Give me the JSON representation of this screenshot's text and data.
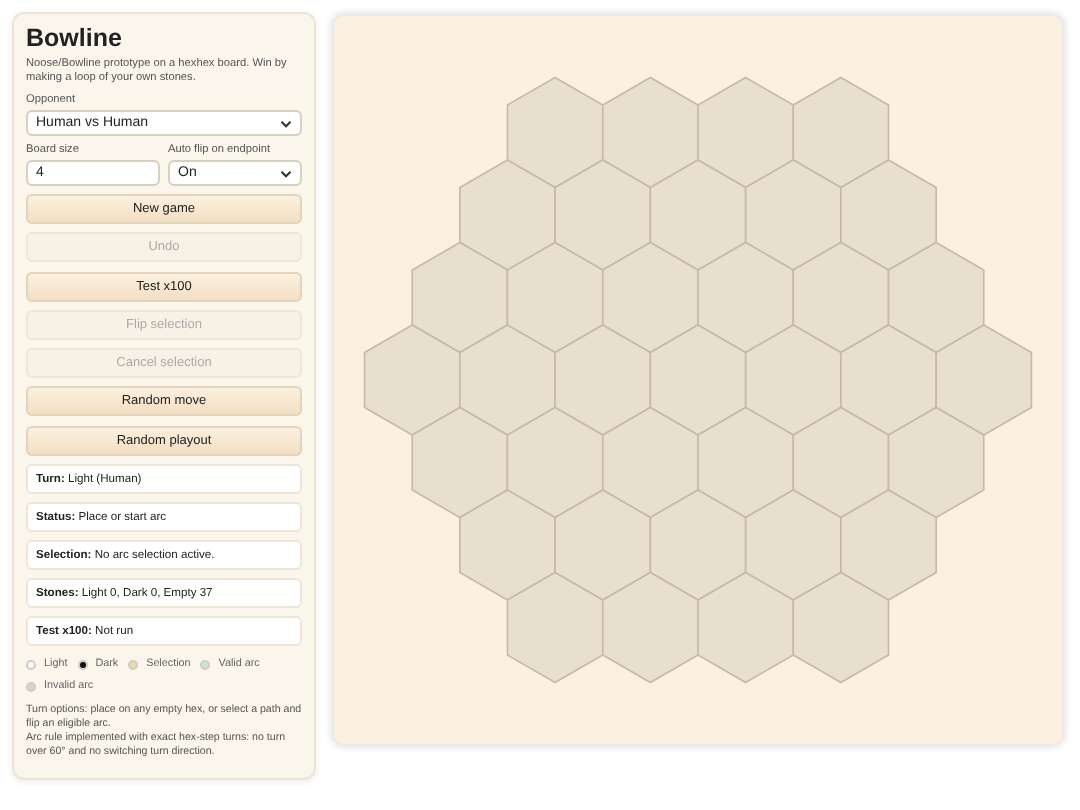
{
  "title": "Bowline",
  "description": "Noose/Bowline prototype on a hexhex board. Win by making a loop of your own stones.",
  "opponent": {
    "label": "Opponent",
    "value": "Human vs Human"
  },
  "board_size": {
    "label": "Board size",
    "value": "4"
  },
  "auto_flip": {
    "label": "Auto flip on endpoint",
    "value": "On"
  },
  "buttons": [
    {
      "label": "New game",
      "disabled": false
    },
    {
      "label": "Undo",
      "disabled": true
    },
    {
      "label": "Test x100",
      "disabled": false
    },
    {
      "label": "Flip selection",
      "disabled": true
    },
    {
      "label": "Cancel selection",
      "disabled": true
    },
    {
      "label": "Random move",
      "disabled": false
    },
    {
      "label": "Random playout",
      "disabled": false
    }
  ],
  "status": [
    {
      "label": "Turn:",
      "value": "Light (Human)"
    },
    {
      "label": "Status:",
      "value": "Place or start arc"
    },
    {
      "label": "Selection:",
      "value": "No arc selection active."
    },
    {
      "label": "Stones:",
      "value": "Light 0, Dark 0, Empty 37"
    },
    {
      "label": "Test x100:",
      "value": "Not run"
    }
  ],
  "legend": [
    {
      "label": "Light",
      "color": "#ffffff"
    },
    {
      "label": "Dark",
      "color": "#111111"
    },
    {
      "label": "Selection",
      "color": "#f0dc96"
    },
    {
      "label": "Valid arc",
      "color": "#d3e2cf"
    },
    {
      "label": "Invalid arc",
      "color": "#ecc9cc"
    }
  ],
  "notes": [
    "Turn options: place on any empty hex, or select a path and flip an eligible arc.",
    "Arc rule implemented with exact hex-step turns: no turn over 60° and no switching turn direction."
  ],
  "board": {
    "rows": [
      [
        {
          "light": false,
          "dark": false
        },
        {
          "light": false,
          "dark": false
        },
        {
          "light": false,
          "dark": false
        },
        {
          "light": false,
          "dark": false
        }
      ],
      [
        {
          "light": false,
          "dark": false
        },
        {
          "light": false,
          "dark": false
        },
        {
          "light": false,
          "dark": false
        },
        {
          "light": false,
          "dark": false
        },
        {
          "light": false,
          "dark": false
        }
      ],
      [
        {
          "light": false,
          "dark": false
        },
        {
          "light": false,
          "dark": false
        },
        {
          "light": false,
          "dark": false
        },
        {
          "light": false,
          "dark": false
        },
        {
          "light": false,
          "dark": false
        },
        {
          "light": false,
          "dark": false
        }
      ],
      [
        {
          "light": false,
          "dark": false
        },
        {
          "light": false,
          "dark": false
        },
        {
          "light": false,
          "dark": false
        },
        {
          "light": false,
          "dark": false
        },
        {
          "light": false,
          "dark": false
        },
        {
          "light": false,
          "dark": false
        },
        {
          "light": false,
          "dark": false
        }
      ],
      [
        {
          "light": false,
          "dark": false
        },
        {
          "light": false,
          "dark": false
        },
        {
          "light": false,
          "dark": false
        },
        {
          "light": false,
          "dark": false
        },
        {
          "light": false,
          "dark": false
        },
        {
          "light": false,
          "dark": false
        }
      ],
      [
        {
          "light": false,
          "dark": false
        },
        {
          "light": false,
          "dark": false
        },
        {
          "light": false,
          "dark": false
        },
        {
          "light": false,
          "dark": false
        },
        {
          "light": false,
          "dark": false
        }
      ],
      [
        {
          "light": false,
          "dark": false
        },
        {
          "light": false,
          "dark": false
        },
        {
          "light": false,
          "dark": false
        },
        {
          "light": false,
          "dark": false
        }
      ]
    ]
  }
}
